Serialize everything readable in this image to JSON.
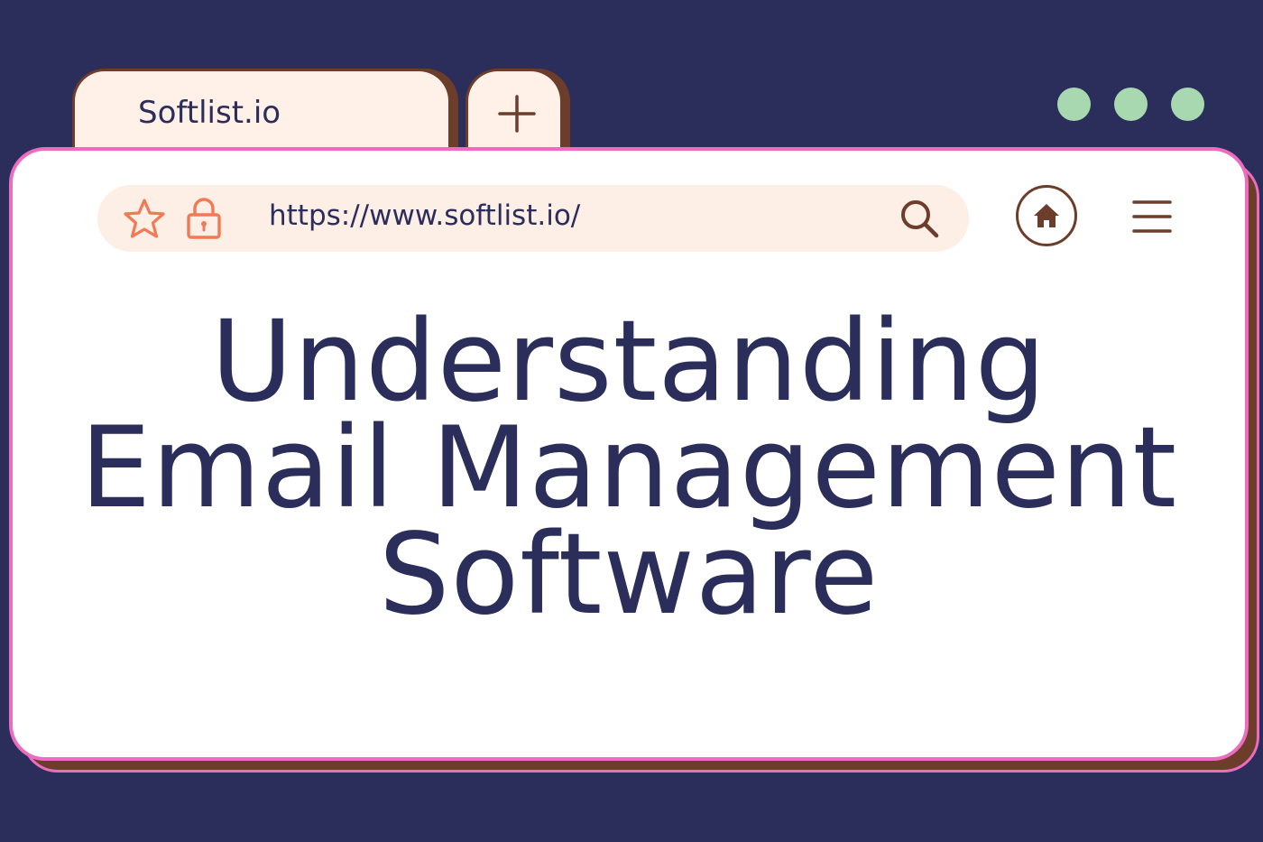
{
  "tabs": [
    {
      "label": "Softlist.io",
      "active": true
    }
  ],
  "new_tab_icon": "plus-icon",
  "window_dots": [
    "dot",
    "dot",
    "dot"
  ],
  "address_bar": {
    "url": "https://www.softlist.io/",
    "left_icons": [
      "star-icon",
      "lock-icon"
    ],
    "right_icon": "search-icon"
  },
  "toolbar": {
    "home_icon": "home-icon",
    "menu_icon": "hamburger-menu-icon"
  },
  "headline": {
    "line1": "Understanding",
    "line2": "Email Management",
    "line3": "Software"
  },
  "colors": {
    "background": "#2b2d5a",
    "tab_fill": "#fff0e8",
    "brown_accent": "#6b3d2a",
    "pink_border": "#ec6cc0",
    "dot_green": "#a8d8b0",
    "icon_orange": "#f07a55",
    "text_navy": "#2b2d5a"
  }
}
